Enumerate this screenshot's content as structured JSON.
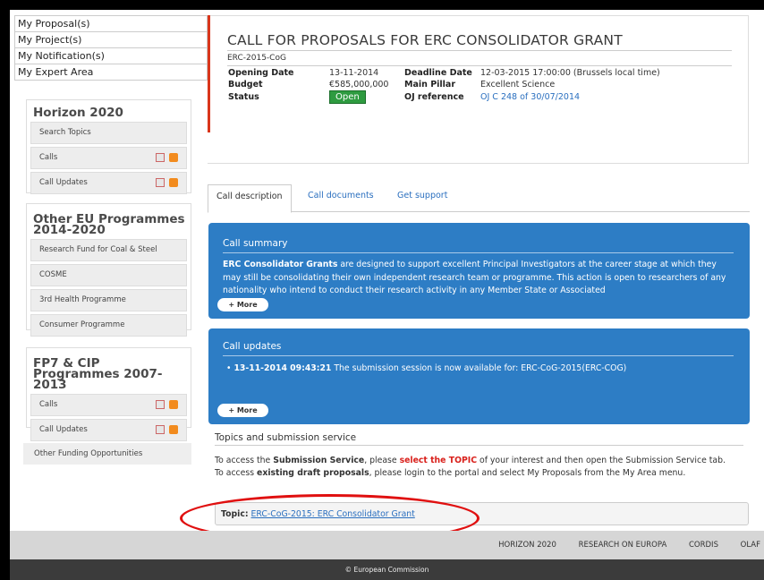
{
  "my_area_menu": [
    "My Proposal(s)",
    "My Project(s)",
    "My Notification(s)",
    "My Expert Area"
  ],
  "sidebar": {
    "horizon": {
      "title": "Horizon 2020",
      "items": [
        {
          "label": "Search Topics"
        },
        {
          "label": "Calls"
        },
        {
          "label": "Call Updates"
        }
      ]
    },
    "other_eu": {
      "title": "Other EU Programmes 2014-2020",
      "items": [
        {
          "label": "Research Fund for Coal & Steel"
        },
        {
          "label": "COSME"
        },
        {
          "label": "3rd Health Programme"
        },
        {
          "label": "Consumer Programme"
        }
      ]
    },
    "fp7": {
      "title": "FP7 & CIP Programmes 2007-2013",
      "items": [
        {
          "label": "Calls"
        },
        {
          "label": "Call Updates"
        }
      ]
    },
    "other_funding": "Other Funding Opportunities"
  },
  "call": {
    "title": "CALL FOR PROPOSALS FOR ERC CONSOLIDATOR GRANT",
    "identifier": "ERC-2015-CoG",
    "opening_date_label": "Opening Date",
    "opening_date": "13-11-2014",
    "deadline_label": "Deadline Date",
    "deadline": "12-03-2015 17:00:00 (Brussels local time)",
    "budget_label": "Budget",
    "budget": "€585,000,000",
    "pillar_label": "Main Pillar",
    "pillar": "Excellent Science",
    "status_label": "Status",
    "status": "Open",
    "oj_label": "OJ reference",
    "oj": "OJ C 248 of 30/07/2014"
  },
  "tabs": [
    "Call description",
    "Call documents",
    "Get support"
  ],
  "summary": {
    "heading": "Call summary",
    "bold": "ERC Consolidator Grants",
    "text": " are designed to support excellent Principal Investigators at the career stage at which they may still be consolidating their own independent research team or programme. This action is open to researchers of any nationality who intend to conduct their research activity in any Member State or Associated",
    "more": "+ More"
  },
  "updates": {
    "heading": "Call updates",
    "timestamp": "13-11-2014 09:43:21",
    "text": " The submission session is now available for: ERC-CoG-2015(ERC-COG)",
    "more": "+ More"
  },
  "submission": {
    "heading": "Topics and submission service",
    "line1_a": "To access the ",
    "line1_b": "Submission Service",
    "line1_c": ", please ",
    "line1_d": "select the TOPIC",
    "line1_e": " of your interest and then open the Submission Service tab.",
    "line2_a": "To access ",
    "line2_b": "existing draft proposals",
    "line2_c": ", please login to the portal and select My Proposals from the My Area menu.",
    "topic_label": "Topic:",
    "topic_link": "ERC-CoG-2015: ERC Consolidator Grant"
  },
  "footer": {
    "links": [
      "HORIZON 2020",
      "RESEARCH ON EUROPA",
      "CORDIS",
      "OLAF"
    ],
    "copyright": "© European Commission"
  },
  "colors": {
    "accent_red": "#d9361b",
    "panel_blue": "#2d7dc5",
    "status_green": "#2e9b40"
  }
}
